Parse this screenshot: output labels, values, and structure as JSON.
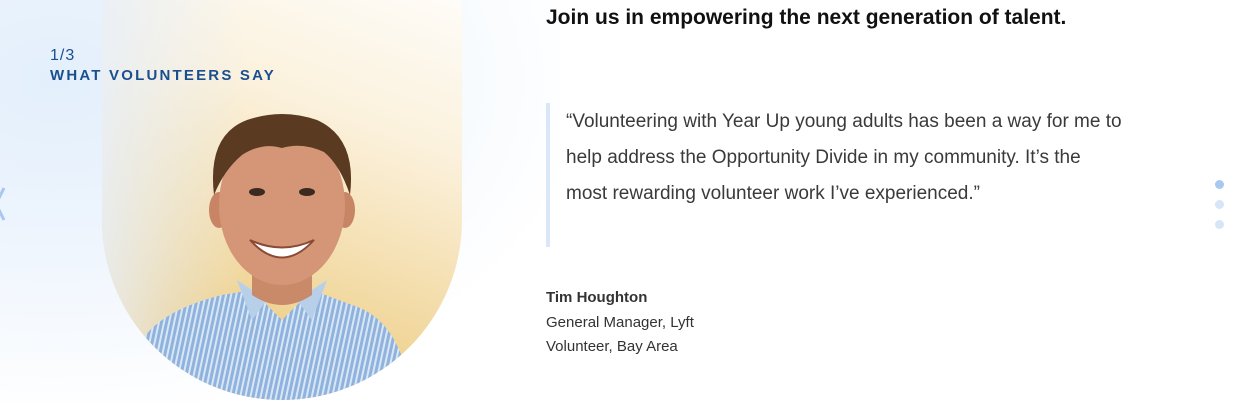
{
  "slider": {
    "counter": "1/3",
    "section_label": "WHAT VOLUNTEERS SAY",
    "active_index": 1,
    "total": 3
  },
  "testimonial": {
    "heading": "Join us in empowering the next generation of talent.",
    "quote": "“Volunteering with Year Up young adults has been a way for me to help address the Opportunity Divide in my community. It’s the most rewarding volunteer work I’ve experienced.”",
    "author_name": "Tim Houghton",
    "author_role": "General Manager, Lyft",
    "author_location": "Volunteer, Bay Area",
    "photo_alt": "Tim Houghton"
  },
  "icons": {
    "prev": "chevron-left-icon",
    "dots": [
      "pagination-dot",
      "pagination-dot",
      "pagination-dot"
    ]
  },
  "colors": {
    "brand_blue": "#1a4f8f",
    "quote_bar": "#d9e7f8",
    "dot_active": "#a9c8ef",
    "dot_inactive": "#d6e5f7",
    "arch_gold": "#e7b957"
  }
}
